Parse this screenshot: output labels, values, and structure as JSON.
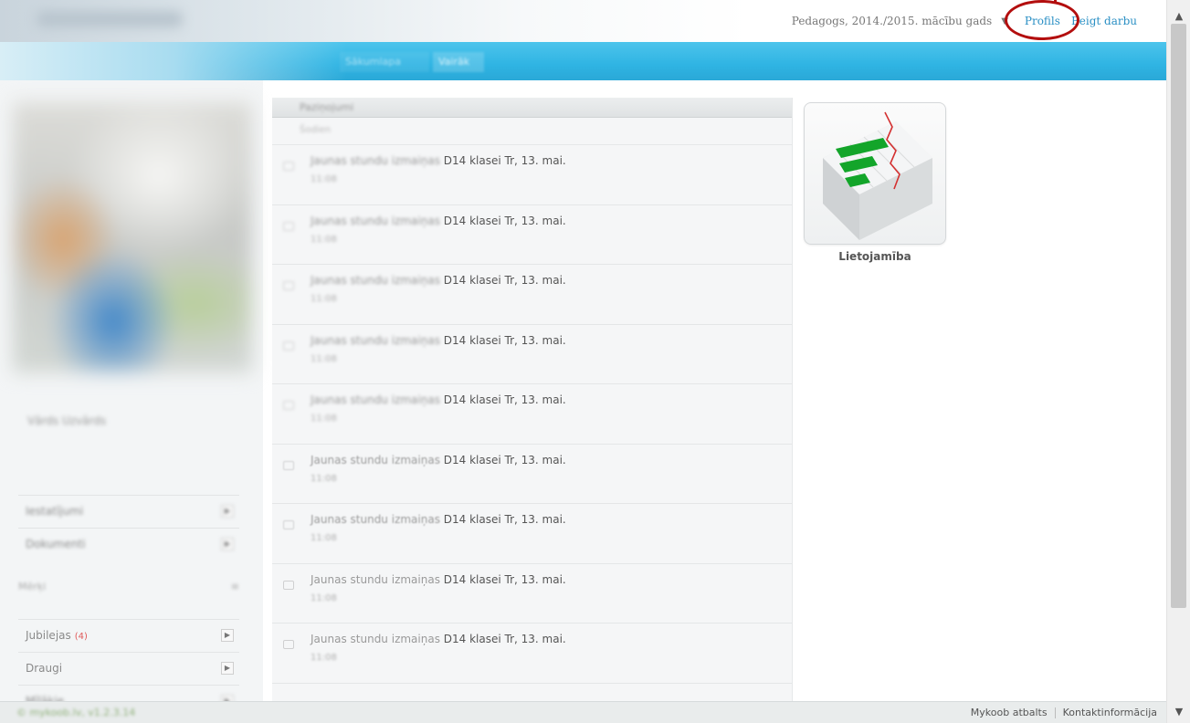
{
  "header": {
    "role_text": "Pedagogs, 2014./2015. mācību gads",
    "profile_label": "Profils",
    "logout_label": "Beigt darbu"
  },
  "nav": {
    "tabs": [
      "Sākumlapa",
      "Vairāk"
    ]
  },
  "sidebar": {
    "user_name": "Vārds Uzvārds",
    "items_top": [
      {
        "label": "Iestatījumi"
      },
      {
        "label": "Dokumenti"
      }
    ],
    "section_title": "Mērķi",
    "items_bottom": [
      {
        "label": "Jubilejas",
        "badge": "(4)"
      },
      {
        "label": "Draugi"
      },
      {
        "label": "Mīļākie"
      }
    ]
  },
  "feed": {
    "header": "Paziņojumi",
    "subheader": "Šodien",
    "items": [
      {
        "prefix": "Jaunas stundu izmaiņas",
        "suffix": " D14 klasei Tr, 13. mai.",
        "time": "11:08"
      },
      {
        "prefix": "Jaunas stundu izmaiņas",
        "suffix": " D14 klasei Tr, 13. mai.",
        "time": "11:08"
      },
      {
        "prefix": "Jaunas stundu izmaiņas",
        "suffix": " D14 klasei Tr, 13. mai.",
        "time": "11:08"
      },
      {
        "prefix": "Jaunas stundu izmaiņas",
        "suffix": " D14 klasei Tr, 13. mai.",
        "time": "11:08"
      },
      {
        "prefix": "Jaunas stundu izmaiņas",
        "suffix": " D14 klasei Tr, 13. mai.",
        "time": "11:08"
      },
      {
        "prefix": "Jaunas stundu izmaiņas",
        "suffix": " D14 klasei Tr, 13. mai.",
        "time": "11:08"
      },
      {
        "prefix": "Jaunas stundu izmaiņas",
        "suffix": " D14 klasei Tr, 13. mai.",
        "time": "11:08"
      },
      {
        "prefix": "Jaunas stundu izmaiņas",
        "suffix": " D14 klasei Tr, 13. mai.",
        "time": "11:08"
      },
      {
        "prefix": "Jaunas stundu izmaiņas",
        "suffix": " D14 klasei Tr, 13. mai.",
        "time": "11:08"
      }
    ]
  },
  "apps": {
    "tiles": [
      {
        "label": "Lietojamība",
        "icon": "bar-chart-icon"
      }
    ]
  },
  "footer": {
    "copyright": "© mykoob.lv, v1.2.3.14",
    "support_label": "Mykoob atbalts",
    "contact_label": "Kontaktinformācija"
  },
  "colors": {
    "accent_blue": "#2fb4e3",
    "link_blue": "#2a8fc4",
    "highlight_red": "#b30e0e",
    "bar_green": "#18a02b"
  }
}
